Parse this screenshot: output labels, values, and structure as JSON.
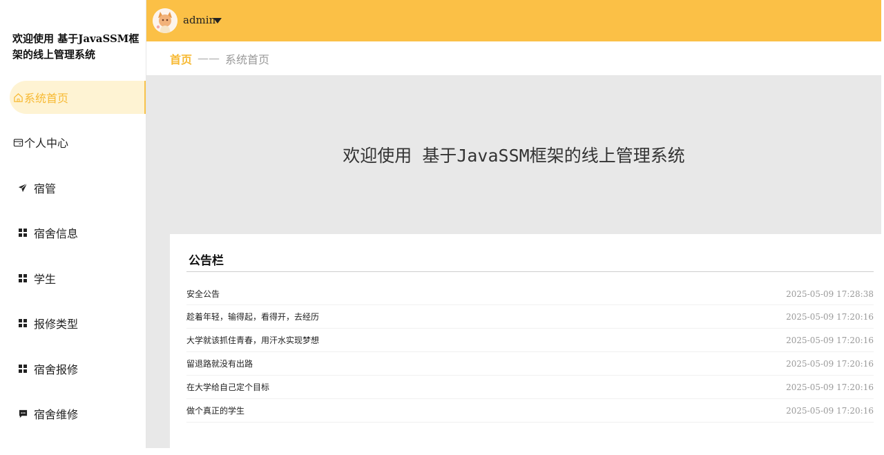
{
  "brand": {
    "title": "欢迎使用 基于JavaSSM框架的线上管理系统"
  },
  "sidebar": {
    "items": [
      {
        "label": "系统首页",
        "icon": "home-icon"
      },
      {
        "label": "个人中心",
        "icon": "wallet-icon"
      },
      {
        "label": "宿管",
        "icon": "send-icon"
      },
      {
        "label": "宿舍信息",
        "icon": "grid-icon"
      },
      {
        "label": "学生",
        "icon": "grid-icon"
      },
      {
        "label": "报修类型",
        "icon": "grid-icon"
      },
      {
        "label": "宿舍报修",
        "icon": "grid-icon"
      },
      {
        "label": "宿舍维修",
        "icon": "comment-icon"
      }
    ]
  },
  "header": {
    "username": "admin"
  },
  "breadcrumb": {
    "home": "首页",
    "separator": "——",
    "current": "系统首页"
  },
  "main": {
    "welcome": "欢迎使用 基于JavaSSM框架的线上管理系统"
  },
  "notice": {
    "title": "公告栏",
    "rows": [
      {
        "title": "安全公告",
        "date": "2025-05-09 17:28:38"
      },
      {
        "title": "趁着年轻，输得起，看得开，去经历",
        "date": "2025-05-09 17:20:16"
      },
      {
        "title": "大学就该抓住青春，用汗水实现梦想",
        "date": "2025-05-09 17:20:16"
      },
      {
        "title": "留退路就没有出路",
        "date": "2025-05-09 17:20:16"
      },
      {
        "title": "在大学给自己定个目标",
        "date": "2025-05-09 17:20:16"
      },
      {
        "title": "做个真正的学生",
        "date": "2025-05-09 17:20:16"
      }
    ]
  },
  "colors": {
    "accent": "#fbc046",
    "active_text": "#f7b932",
    "active_bg": "#fef3d3",
    "main_bg": "#e8e8e8"
  }
}
